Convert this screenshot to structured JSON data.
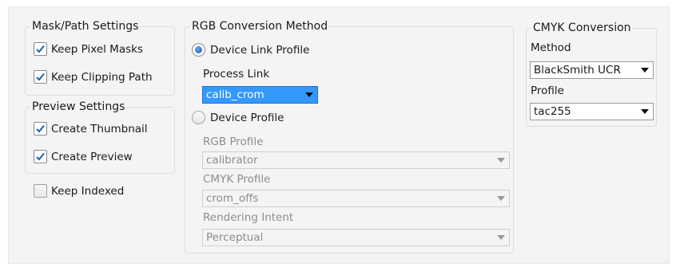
{
  "mask_path": {
    "title": "Mask/Path Settings",
    "keep_pixel_masks": {
      "label": "Keep Pixel Masks",
      "checked": true
    },
    "keep_clipping_path": {
      "label": "Keep Clipping Path",
      "checked": true
    }
  },
  "preview": {
    "title": "Preview Settings",
    "create_thumbnail": {
      "label": "Create Thumbnail",
      "checked": true
    },
    "create_preview": {
      "label": "Create Preview",
      "checked": true
    }
  },
  "keep_indexed": {
    "label": "Keep Indexed",
    "checked": false
  },
  "rgb": {
    "title": "RGB Conversion Method",
    "device_link": {
      "label": "Device Link Profile",
      "selected": true
    },
    "process_link_label": "Process Link",
    "process_link_value": "calib_crom",
    "device_profile": {
      "label": "Device Profile",
      "selected": false
    },
    "rgb_profile_label": "RGB Profile",
    "rgb_profile_value": "calibrator",
    "cmyk_profile_label": "CMYK Profile",
    "cmyk_profile_value": "crom_offs",
    "rendering_intent_label": "Rendering Intent",
    "rendering_intent_value": "Perceptual"
  },
  "cmyk": {
    "title": "CMYK Conversion",
    "method_label": "Method",
    "method_value": "BlackSmith UCR",
    "profile_label": "Profile",
    "profile_value": "tac255"
  },
  "colors": {
    "accent": "#3399ff",
    "check": "#1c5fb4",
    "disabled_text": "#8c8c8c"
  }
}
